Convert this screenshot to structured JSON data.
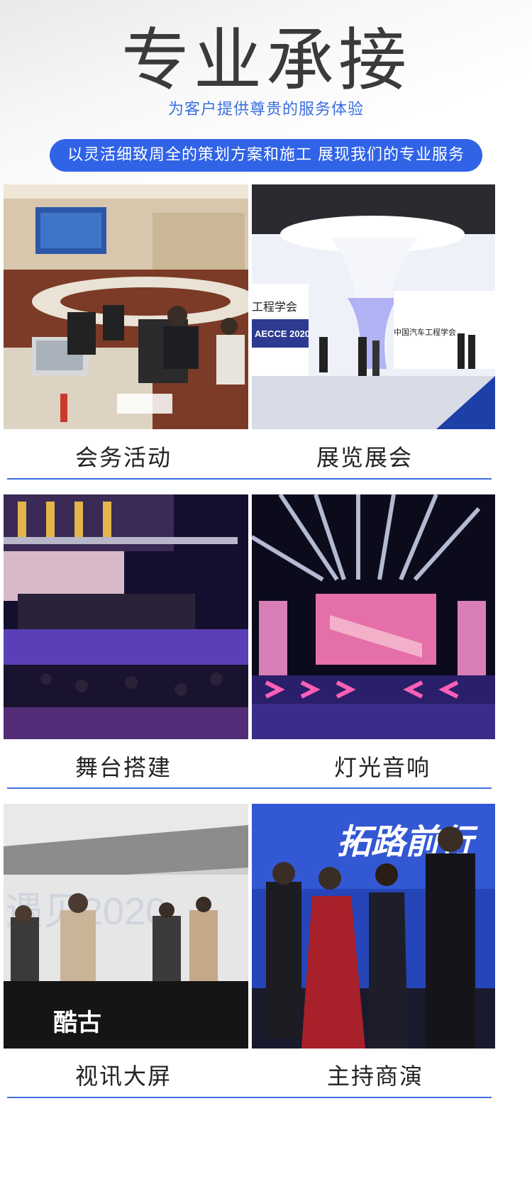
{
  "header": {
    "title": "专业承接",
    "subtitle": "为客户提供尊贵的服务体验",
    "tagline": "以灵活细致周全的策划方案和施工 展现我们的专业服务"
  },
  "services": [
    {
      "label": "会务活动"
    },
    {
      "label": "展览展会"
    },
    {
      "label": "舞台搭建"
    },
    {
      "label": "灯光音响"
    },
    {
      "label": "视讯大屏"
    },
    {
      "label": "主持商演"
    }
  ],
  "photo_text": {
    "exhibition_banner": "AECCE 2020",
    "exhibition_sign": "工程学会",
    "exhibition_sign2": "中国汽车工程学会",
    "screen_brand": "酷古",
    "screen_text": "遇见2020",
    "host_banner": "拓路前行"
  },
  "colors": {
    "accent": "#3063e6",
    "title": "#3a3a3a",
    "subtitle": "#3a6fe0",
    "rule": "#3f6fe3"
  }
}
